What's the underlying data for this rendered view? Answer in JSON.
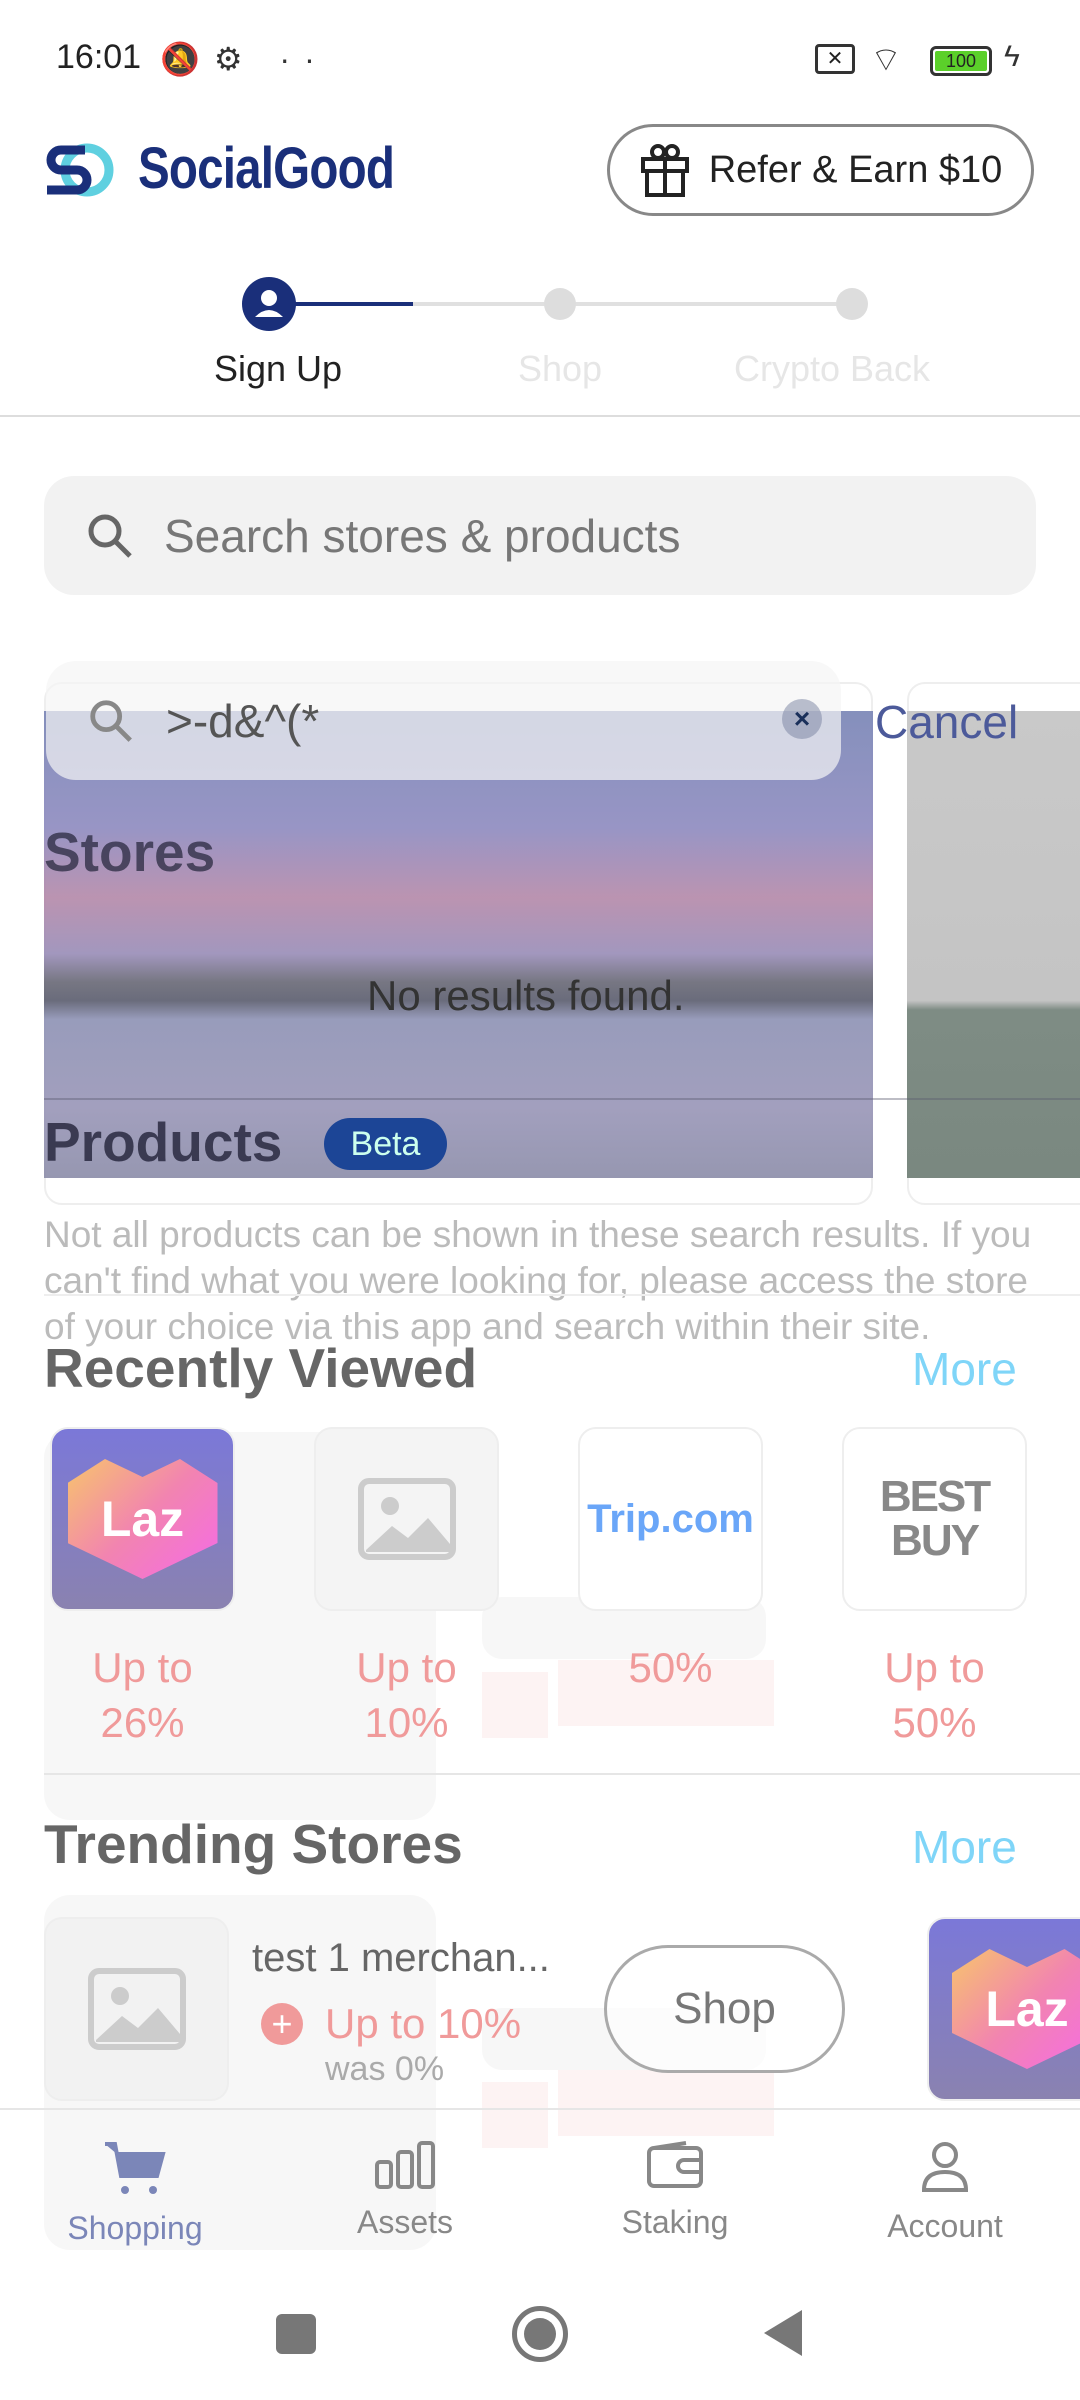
{
  "status_bar": {
    "time": "16:01",
    "battery": "100"
  },
  "header": {
    "brand": "SocialGood",
    "refer_label": "Refer & Earn $10"
  },
  "stepper": {
    "steps": [
      {
        "label": "Sign Up"
      },
      {
        "label": "Shop"
      },
      {
        "label": "Crypto Back"
      }
    ]
  },
  "search": {
    "placeholder": "Search stores & products"
  },
  "overlay": {
    "query": ">-d&^(*",
    "cancel": "Cancel",
    "stores_title": "Stores",
    "no_results": "No results found.",
    "products_title": "Products",
    "beta": "Beta",
    "disclaimer": "Not all products can be shown in these search results. If you can't find what you were looking for, please access the store of your choice via this app and search within their site."
  },
  "recently_viewed": {
    "title": "Recently Viewed",
    "more": "More",
    "items": [
      {
        "logo": "Laz",
        "line1": "Up to",
        "line2": "26%"
      },
      {
        "logo": "",
        "line1": "Up to",
        "line2": "10%"
      },
      {
        "logo": "Trip.com",
        "line1": "",
        "line2": "50%"
      },
      {
        "logo": "BEST BUY",
        "line1": "Up to",
        "line2": "50%"
      }
    ]
  },
  "trending": {
    "title": "Trending Stores",
    "more": "More",
    "item": {
      "name": "test 1 merchan...",
      "cashback": "Up to 10%",
      "was": "was 0%",
      "shop": "Shop"
    },
    "next_logo": "Laz"
  },
  "bottom_nav": [
    {
      "label": "Shopping"
    },
    {
      "label": "Assets"
    },
    {
      "label": "Staking"
    },
    {
      "label": "Account"
    }
  ],
  "colors": {
    "brand": "#1a2f7a",
    "accent": "#7fd5f8",
    "cashback": "#f09a9a"
  }
}
